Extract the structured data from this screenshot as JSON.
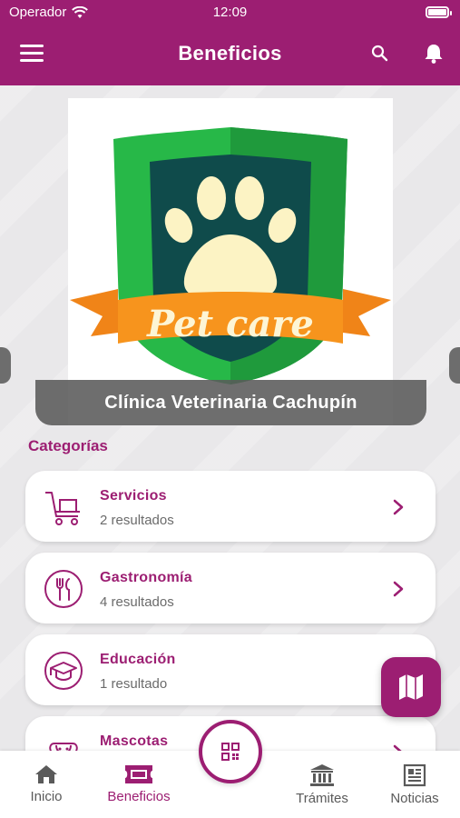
{
  "status_bar": {
    "carrier": "Operador",
    "time": "12:09"
  },
  "header": {
    "title": "Beneficios"
  },
  "banner": {
    "logo_text": "Pet care",
    "caption": "Clínica Veterinaria Cachupín"
  },
  "section": {
    "title": "Categorías"
  },
  "categories": [
    {
      "name": "Servicios",
      "count": "2 resultados",
      "icon": "shopping-cart-icon"
    },
    {
      "name": "Gastronomía",
      "count": "4 resultados",
      "icon": "fork-knife-icon"
    },
    {
      "name": "Educación",
      "count": "1 resultado",
      "icon": "graduation-cap-icon"
    },
    {
      "name": "Mascotas",
      "count": "",
      "icon": "dog-icon"
    }
  ],
  "tabbar": {
    "items": [
      {
        "label": "Inicio",
        "icon": "home-icon"
      },
      {
        "label": "Beneficios",
        "icon": "ticket-icon",
        "active": true
      },
      {
        "label": "Trámites",
        "icon": "bank-icon"
      },
      {
        "label": "Noticias",
        "icon": "newspaper-icon"
      }
    ]
  },
  "colors": {
    "brand": "#9c1e72",
    "background": "#e9e8ea"
  }
}
